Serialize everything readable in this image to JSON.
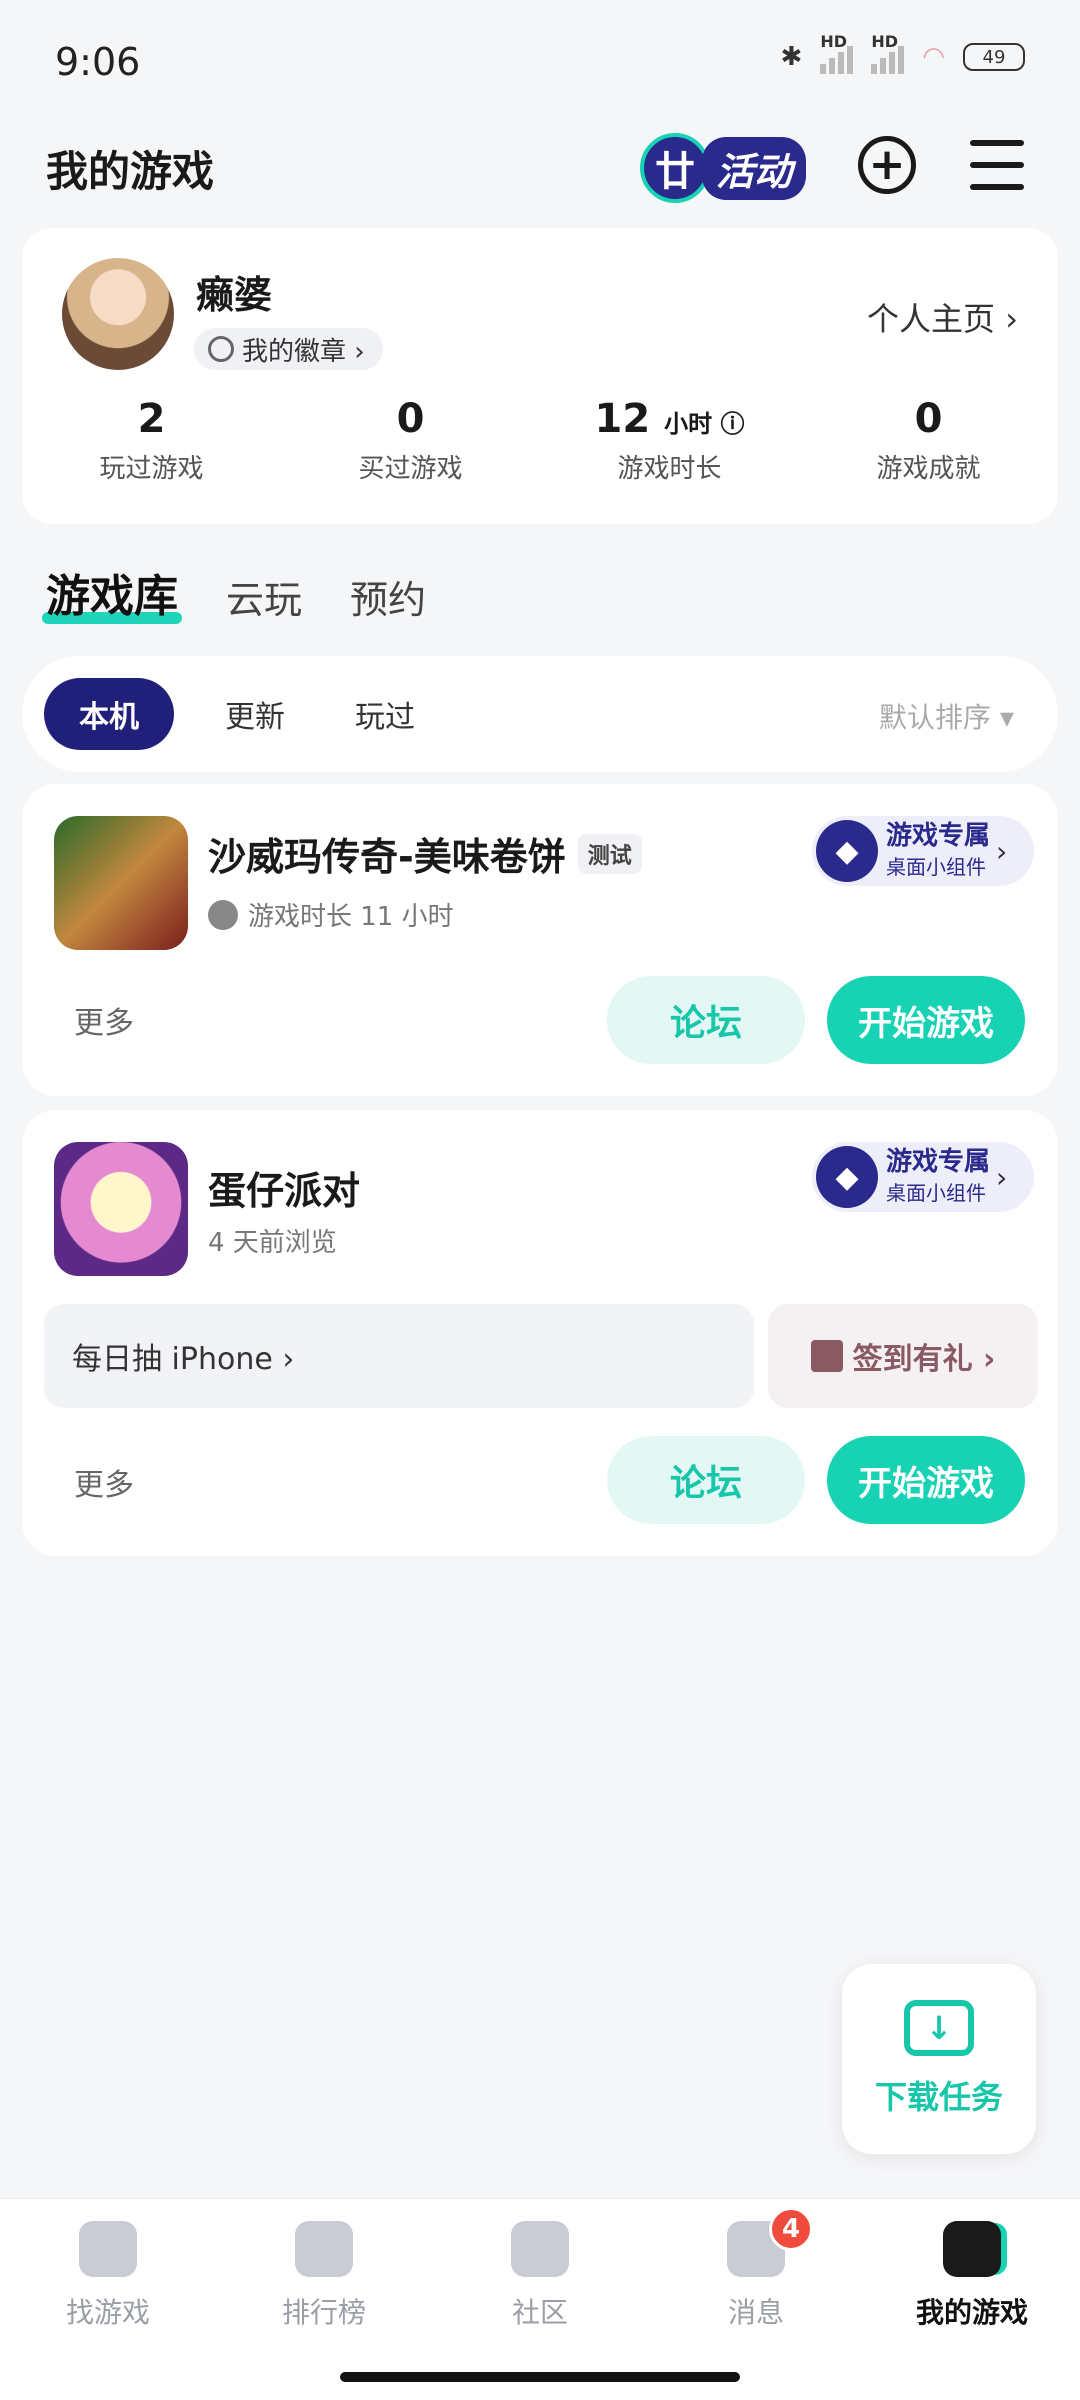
{
  "status_bar": {
    "time": "9:06",
    "battery": "49",
    "hd": "HD"
  },
  "header": {
    "title": "我的游戏",
    "activity_glyph": "廿",
    "activity_label": "活动",
    "add_glyph": "+"
  },
  "profile": {
    "username": "癞婆",
    "badge_label": "我的徽章 ›",
    "homepage_label": "个人主页 ›",
    "stats": [
      {
        "value": "2",
        "unit": "",
        "label": "玩过游戏"
      },
      {
        "value": "0",
        "unit": "",
        "label": "买过游戏"
      },
      {
        "value": "12",
        "unit": "小时 ⓘ",
        "label": "游戏时长"
      },
      {
        "value": "0",
        "unit": "",
        "label": "游戏成就"
      }
    ]
  },
  "tabs": [
    "游戏库",
    "云玩",
    "预约"
  ],
  "filters": {
    "chips": [
      "本机",
      "更新",
      "玩过"
    ],
    "sort_label": "默认排序 ▾"
  },
  "games": [
    {
      "title": "沙威玛传奇-美味卷饼",
      "tag": "测试",
      "subtitle": "游戏时长 11 小时",
      "widget_title": "游戏专属",
      "widget_sub": "桌面小组件",
      "more": "更多",
      "forum": "论坛",
      "start": "开始游戏"
    },
    {
      "title": "蛋仔派对",
      "subtitle": "4 天前浏览",
      "widget_title": "游戏专属",
      "widget_sub": "桌面小组件",
      "promo_left": "每日抽 iPhone ›",
      "promo_right": "签到有礼 ›",
      "more": "更多",
      "forum": "论坛",
      "start": "开始游戏"
    }
  ],
  "download": {
    "label": "下载任务"
  },
  "bottom_nav": [
    {
      "label": "找游戏"
    },
    {
      "label": "排行榜"
    },
    {
      "label": "社区"
    },
    {
      "label": "消息",
      "badge": "4"
    },
    {
      "label": "我的游戏"
    }
  ],
  "colors": {
    "accent": "#18d2b4",
    "brand_navy": "#20207a",
    "badge_red": "#f04b3c"
  }
}
